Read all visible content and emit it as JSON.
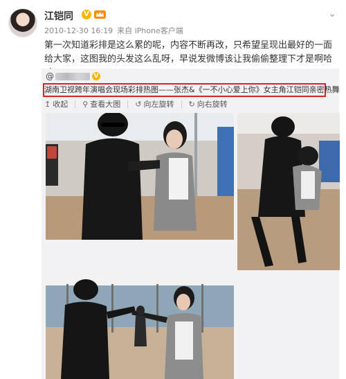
{
  "post": {
    "author": "江铠同",
    "verified_badge": "V",
    "timestamp": "2010-12-30 16:19",
    "source": "来自 iPhone客户端",
    "text": "第一次知道彩排是这么累的呢，内容不断再改，只希望呈现出最好的一面给大家，这图我的头发这么乱呀，早说发微博该让我偷偷整理下才是啊哈哈"
  },
  "repost": {
    "at_sign": "@",
    "verified_badge": "V",
    "text": "湖南卫视跨年演唱会现场彩排热图——张杰&《一不小心爱上你》女主角江铠同亲密热舞",
    "actions": {
      "collect": "收起",
      "view_large": "查看大图",
      "rotate_left": "向左旋转",
      "rotate_right": "向右旋转"
    }
  },
  "icons": {
    "collapse": "arrow-up-icon",
    "view_large": "magnifier-icon",
    "rotate_left": "rotate-left-icon",
    "rotate_right": "rotate-right-icon",
    "menu": "chevron-down-icon"
  },
  "colors": {
    "highlight_border": "#e02020",
    "verified": "#f7b500",
    "repost_background": "#f2f2f5"
  }
}
